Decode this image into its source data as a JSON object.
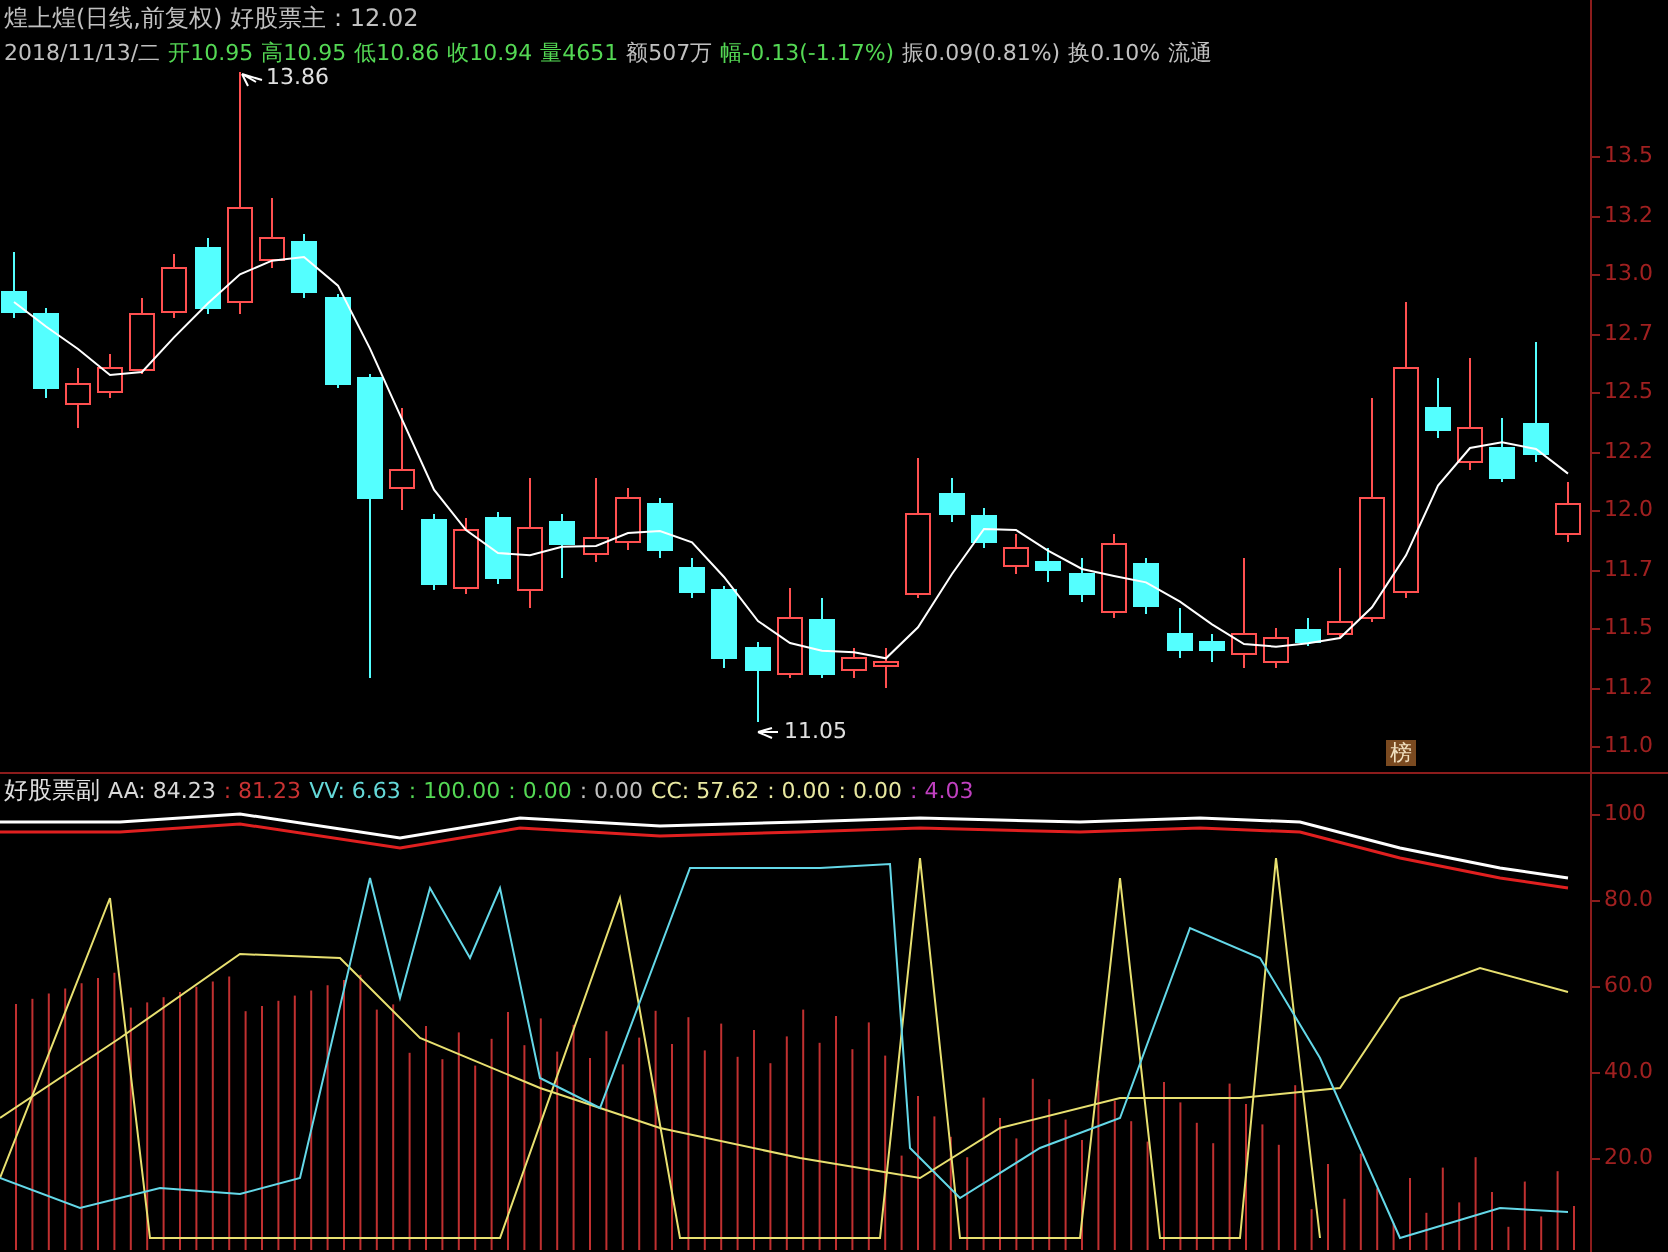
{
  "main_pane": {
    "title_items": [
      {
        "text": "煌上煌(日线,前复权)",
        "color": "#c0c0c0"
      },
      {
        "text": "好股票主 : 12.02",
        "color": "#c0c0c0"
      }
    ],
    "quote_items": [
      {
        "text": "2018/11/13/二",
        "color": "#c0c0c0"
      },
      {
        "text": "开10.95",
        "color": "#54d854"
      },
      {
        "text": "高10.95",
        "color": "#54d854"
      },
      {
        "text": "低10.86",
        "color": "#54d854"
      },
      {
        "text": "收10.94",
        "color": "#54d854"
      },
      {
        "text": "量4651",
        "color": "#54d854"
      },
      {
        "text": "额507万",
        "color": "#c0c0c0"
      },
      {
        "text": "幅-0.13(-1.17%)",
        "color": "#54d854"
      },
      {
        "text": "振0.09(0.81%)",
        "color": "#c0c0c0"
      },
      {
        "text": "换0.10%",
        "color": "#c0c0c0"
      },
      {
        "text": "流通",
        "color": "#c0c0c0"
      }
    ],
    "high_label": "13.86",
    "low_label": "11.05",
    "badge": "榜",
    "axis_labels": [
      "13.5",
      "13.2",
      "13.0",
      "12.7",
      "12.5",
      "12.2",
      "12.0",
      "11.7",
      "11.5",
      "11.2",
      "11.0"
    ]
  },
  "sub_pane": {
    "name": "好股票副",
    "values": [
      {
        "text": "AA: 84.23",
        "color": "#d8d8d8"
      },
      {
        "text": ": 81.23",
        "color": "#c83232"
      },
      {
        "text": "VV: 6.63",
        "color": "#64d8d8"
      },
      {
        "text": ": 100.00",
        "color": "#54d854"
      },
      {
        "text": ": 0.00",
        "color": "#54d854"
      },
      {
        "text": ": 0.00",
        "color": "#c0c0c0"
      },
      {
        "text": "CC: 57.62",
        "color": "#e8e8a0"
      },
      {
        "text": ": 0.00",
        "color": "#e8e8a0"
      },
      {
        "text": ": 0.00",
        "color": "#e8e8a0"
      },
      {
        "text": ": 4.03",
        "color": "#c040c0"
      }
    ],
    "axis_labels": [
      "100",
      "80.0",
      "60.0",
      "40.0",
      "20.0"
    ]
  }
}
